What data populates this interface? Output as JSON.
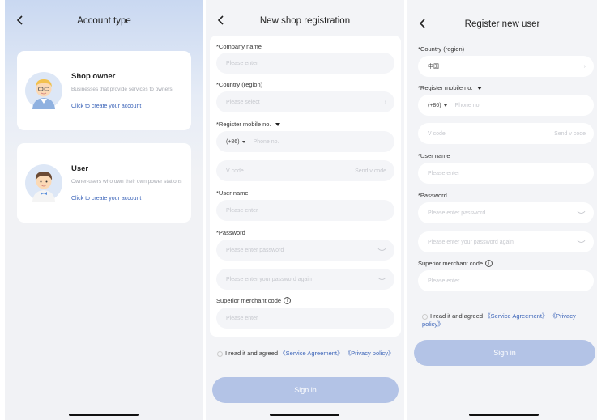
{
  "account_type": {
    "title": "Account type",
    "shop_owner": {
      "title": "Shop owner",
      "desc": "Businesses that provide services to owners",
      "link": "Click to create your account"
    },
    "user": {
      "title": "User",
      "desc": "Owner-users who own their own power stations",
      "link": "Click to create your account"
    }
  },
  "shop_registration": {
    "title": "New shop registration",
    "company_label": "*Company name",
    "company_placeholder": "Please enter",
    "country_label": "*Country (region)",
    "country_placeholder": "Please select",
    "mobile_label": "*Register mobile no.",
    "country_code": "(+86)",
    "phone_placeholder": "Phone no.",
    "vcode_placeholder": "V code",
    "send_vcode": "Send v code",
    "username_label": "*User name",
    "username_placeholder": "Please enter",
    "password_label": "*Password",
    "password_placeholder": "Please enter password",
    "password_again_placeholder": "Please enter your password again",
    "merchant_label": "Superior merchant code",
    "merchant_placeholder": "Please enter",
    "agree_text": "I read it and agreed",
    "service_link": "《Service Agreement》",
    "privacy_link": "《Privacy policy》",
    "signin": "Sign in"
  },
  "user_registration": {
    "title": "Register new user",
    "country_label": "*Country (region)",
    "country_value": "中国",
    "mobile_label": "*Register mobile no.",
    "country_code": "(+86)",
    "phone_placeholder": "Phone no.",
    "vcode_placeholder": "V code",
    "send_vcode": "Send v code",
    "username_label": "*User name",
    "username_placeholder": "Please enter",
    "password_label": "*Password",
    "password_placeholder": "Please enter password",
    "password_again_placeholder": "Please enter your password again",
    "merchant_label": "Superior merchant code",
    "merchant_placeholder": "Please enter",
    "agree_text": "I read it and agreed",
    "service_link": "《Service Agreement》",
    "privacy_link": "《Privacy policy》",
    "signin": "Sign in"
  },
  "colors": {
    "accent": "#3a63b8",
    "button_disabled": "#b3c3e6",
    "field_bg": "#f4f5f8",
    "page_bg": "#f3f4f7"
  },
  "icons": {
    "back": "chevron-left-icon",
    "eye": "eye-closed-icon",
    "info": "info-circle-icon",
    "dropdown": "chevron-right-icon"
  }
}
